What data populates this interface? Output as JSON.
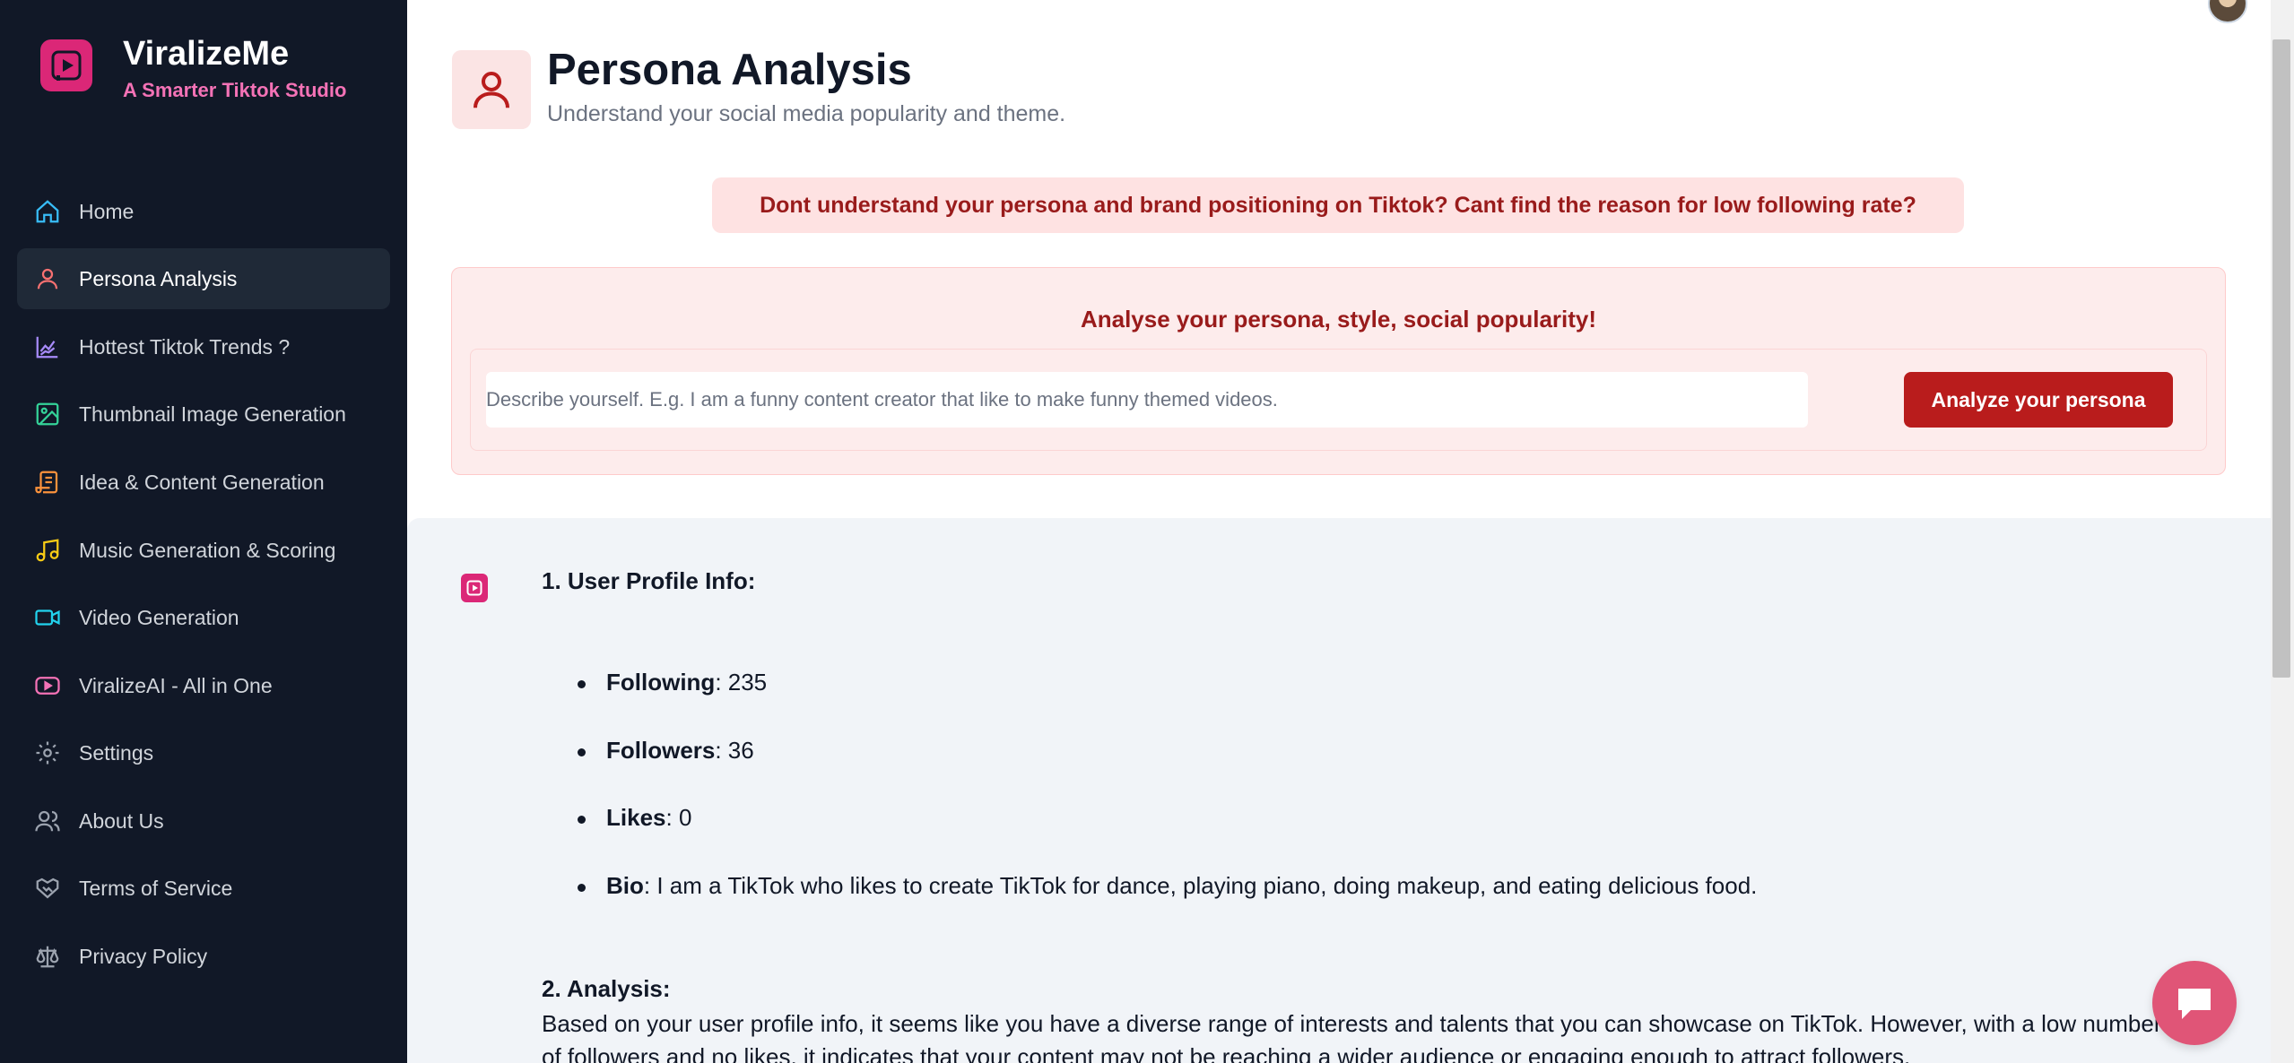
{
  "brand": {
    "name": "ViralizeMe",
    "tagline": "A Smarter Tiktok Studio"
  },
  "sidebar": {
    "items": [
      {
        "label": "Home",
        "icon": "home-icon",
        "color": "#38bdf8"
      },
      {
        "label": "Persona Analysis",
        "icon": "user-icon",
        "color": "#f87171",
        "active": true
      },
      {
        "label": "Hottest Tiktok Trends ?",
        "icon": "chart-icon",
        "color": "#a78bfa"
      },
      {
        "label": "Thumbnail Image Generation",
        "icon": "image-icon",
        "color": "#34d399"
      },
      {
        "label": "Idea & Content Generation",
        "icon": "scroll-icon",
        "color": "#fb923c"
      },
      {
        "label": "Music Generation & Scoring",
        "icon": "music-icon",
        "color": "#facc15"
      },
      {
        "label": "Video Generation",
        "icon": "video-icon",
        "color": "#22d3ee"
      },
      {
        "label": "ViralizeAI - All in One",
        "icon": "play-icon",
        "color": "#f472b6"
      },
      {
        "label": "Settings",
        "icon": "gear-icon",
        "color": "#9ca3af"
      },
      {
        "label": "About Us",
        "icon": "users-icon",
        "color": "#9ca3af"
      },
      {
        "label": "Terms of Service",
        "icon": "handshake-icon",
        "color": "#9ca3af"
      },
      {
        "label": "Privacy Policy",
        "icon": "scale-icon",
        "color": "#9ca3af"
      }
    ]
  },
  "header": {
    "title": "Persona Analysis",
    "subtitle": "Understand your social media popularity and theme."
  },
  "banner": {
    "text": "Dont understand your persona and brand positioning on Tiktok? Cant find the reason for low following rate?"
  },
  "analyse": {
    "title": "Analyse your persona, style, social popularity!",
    "placeholder": "Describe yourself. E.g. I am a funny content creator that like to make funny themed videos.",
    "button_label": "Analyze your persona"
  },
  "result": {
    "section1_heading": "1. User Profile Info:",
    "profile": [
      {
        "key": "Following",
        "value": ": 235"
      },
      {
        "key": "Followers",
        "value": ": 36"
      },
      {
        "key": "Likes",
        "value": ": 0"
      },
      {
        "key": "Bio",
        "value": ": I am a TikTok who likes to create TikTok for dance, playing piano, doing makeup, and eating delicious food."
      }
    ],
    "section2_heading": "2. Analysis:",
    "analysis_text": "Based on your user profile info, it seems like you have a diverse range of interests and talents that you can showcase on TikTok. However, with a low number of followers and no likes, it indicates that your content may not be reaching a wider audience or engaging enough to attract followers."
  },
  "colors": {
    "accent": "#b91c1c",
    "brand": "#db2777",
    "sidebar_bg": "#111827"
  }
}
